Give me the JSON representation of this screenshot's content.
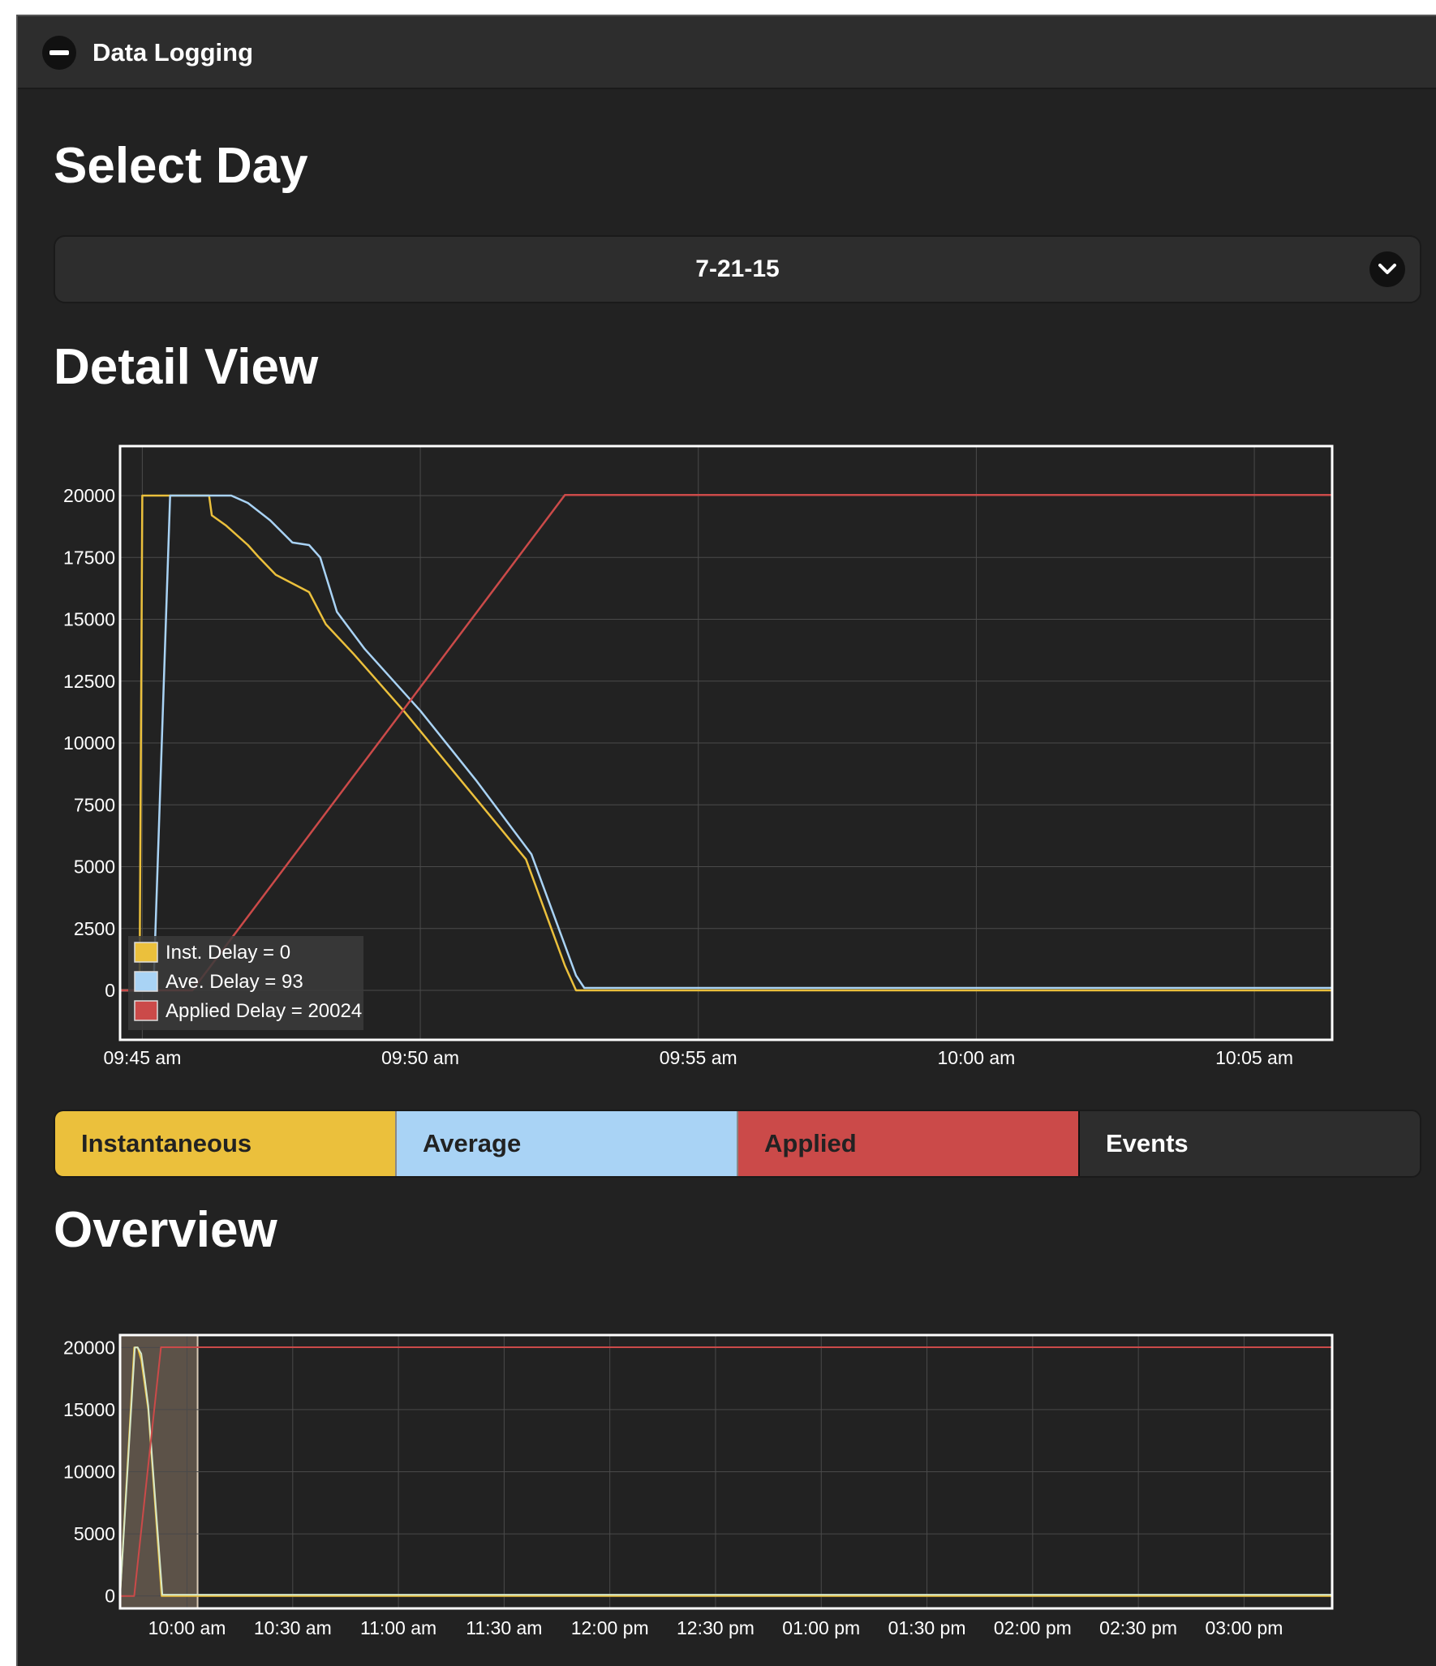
{
  "panel": {
    "title": "Data Logging"
  },
  "select_day": {
    "title": "Select Day",
    "value": "7-21-15"
  },
  "detail": {
    "title": "Detail View"
  },
  "overview": {
    "title": "Overview"
  },
  "toggles": {
    "instantaneous": "Instantaneous",
    "average": "Average",
    "applied": "Applied",
    "events": "Events"
  },
  "colors": {
    "inst": "#ebc03c",
    "avg": "#a9d3f5",
    "applied": "#cb4a49",
    "panel_bg": "#222222"
  },
  "chart_data": [
    {
      "type": "line",
      "title": "",
      "x_unit": "minutes past 09:45 am",
      "xlim": [
        -0.4,
        21.4
      ],
      "ylim": [
        -2000,
        22000
      ],
      "x_ticks": [
        0,
        5,
        10,
        15,
        20
      ],
      "x_tick_labels": [
        "09:45 am",
        "09:50 am",
        "09:55 am",
        "10:00 am",
        "10:05 am"
      ],
      "y_ticks": [
        0,
        2500,
        5000,
        7500,
        10000,
        12500,
        15000,
        17500,
        20000
      ],
      "y_tick_labels": [
        "0",
        "2500",
        "5000",
        "7500",
        "10000",
        "12500",
        "15000",
        "17500",
        "20000"
      ],
      "legend_position": "bottom-left",
      "series": [
        {
          "name": "Inst. Delay",
          "legend": "Inst. Delay = 0",
          "color": "#ebc03c",
          "x": [
            -0.4,
            -0.05,
            0.0,
            1.2,
            1.25,
            1.5,
            1.9,
            2.1,
            2.4,
            3.0,
            3.3,
            3.8,
            4.7,
            5.8,
            6.9,
            7.6,
            7.8,
            21.4
          ],
          "y": [
            0,
            0,
            20000,
            20000,
            19200,
            18800,
            18000,
            17500,
            16800,
            16100,
            14800,
            13600,
            11300,
            8300,
            5300,
            1000,
            0,
            0
          ]
        },
        {
          "name": "Ave. Delay",
          "legend": "Ave. Delay = 93",
          "color": "#a9d3f5",
          "x": [
            -0.4,
            0.2,
            0.5,
            1.2,
            1.6,
            1.9,
            2.3,
            2.7,
            3.0,
            3.2,
            3.5,
            4.0,
            5.0,
            6.0,
            7.0,
            7.8,
            7.95,
            21.4
          ],
          "y": [
            0,
            0,
            20000,
            20000,
            20000,
            19700,
            19000,
            18100,
            18000,
            17500,
            15300,
            13800,
            11300,
            8500,
            5500,
            600,
            100,
            100
          ]
        },
        {
          "name": "Applied Delay",
          "legend": "Applied Delay = 20024",
          "color": "#cb4a49",
          "x": [
            -0.4,
            0.9,
            7.6,
            21.4
          ],
          "y": [
            0,
            0,
            20024,
            20024
          ]
        }
      ]
    },
    {
      "type": "line",
      "title": "",
      "x_unit": "minutes past 09:45 am",
      "xlim": [
        -4,
        340
      ],
      "ylim": [
        -1000,
        21000
      ],
      "x_ticks": [
        15,
        45,
        75,
        105,
        135,
        165,
        195,
        225,
        255,
        285,
        315
      ],
      "x_tick_labels": [
        "10:00 am",
        "10:30 am",
        "11:00 am",
        "11:30 am",
        "12:00 pm",
        "12:30 pm",
        "01:00 pm",
        "01:30 pm",
        "02:00 pm",
        "02:30 pm",
        "03:00 pm"
      ],
      "y_ticks": [
        0,
        5000,
        10000,
        15000,
        20000
      ],
      "y_tick_labels": [
        "0",
        "5000",
        "10000",
        "15000",
        "20000"
      ],
      "selection": [
        -4,
        18
      ],
      "series": [
        {
          "name": "Instantaneous",
          "color": "#ebc03c",
          "x": [
            -4,
            0,
            1,
            2,
            3,
            4,
            7.8,
            340
          ],
          "y": [
            0,
            20000,
            20000,
            19000,
            17000,
            15000,
            0,
            0
          ]
        },
        {
          "name": "Average",
          "color": "#d6e8c8",
          "x": [
            -4,
            0.2,
            1,
            2,
            3,
            4,
            8,
            340
          ],
          "y": [
            0,
            20000,
            20000,
            19500,
            17500,
            15300,
            100,
            100
          ]
        },
        {
          "name": "Applied",
          "color": "#cb4a49",
          "x": [
            -4,
            0,
            7.6,
            340
          ],
          "y": [
            0,
            0,
            20024,
            20024
          ]
        }
      ]
    }
  ]
}
